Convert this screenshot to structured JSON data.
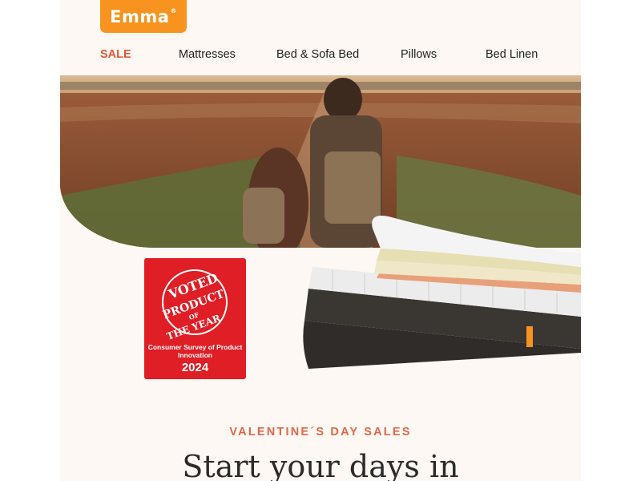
{
  "brand": {
    "logo_text": "Emma",
    "logo_mark": "®",
    "accent": "#f7931e"
  },
  "nav": {
    "items": [
      {
        "label": "SALE",
        "highlight": "#e4573a"
      },
      {
        "label": "Mattresses"
      },
      {
        "label": "Bed & Sofa Bed"
      },
      {
        "label": "Pillows"
      },
      {
        "label": "Bed Linen"
      }
    ]
  },
  "hero": {
    "image": "couple-with-backpacks-walking-field-path"
  },
  "badge": {
    "line1": "VOTED",
    "line2": "PRODUCT",
    "line3": "OF",
    "line4": "THE YEAR",
    "survey": "Consumer Survey of Product Innovation",
    "year": "2024",
    "color": "#e01e26"
  },
  "promo": {
    "kicker": "VALENTINE´S DAY SALES",
    "headline": "Start your days in"
  }
}
